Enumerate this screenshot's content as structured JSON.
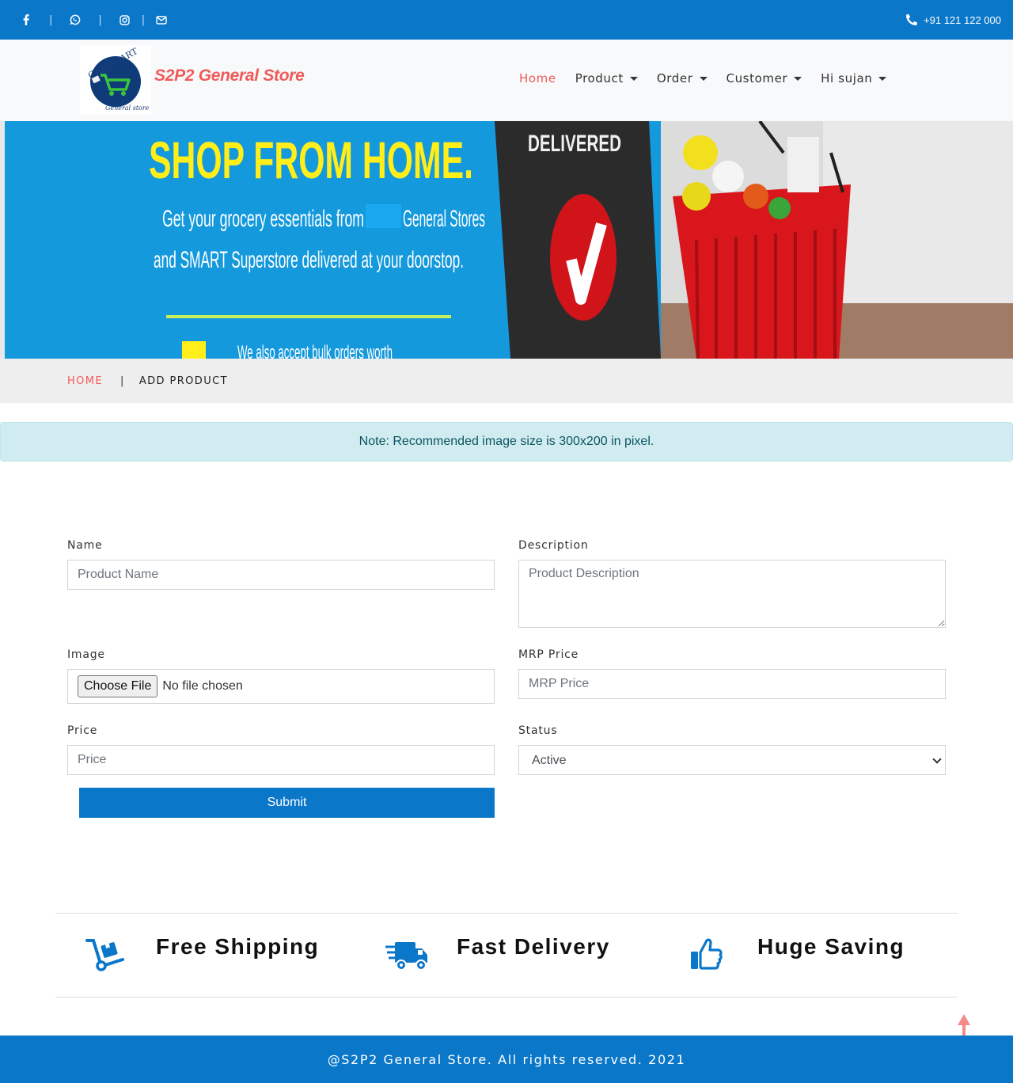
{
  "topbar": {
    "social_icons": [
      "facebook-icon",
      "whatsapp-icon",
      "instagram-icon",
      "envelope-icon"
    ],
    "separator": "|",
    "phone": "+91 121 122 000"
  },
  "navbar": {
    "brand": "S2P2 General Store",
    "logo_text_top": "GrocSMART",
    "logo_text_bottom": "General store",
    "items": [
      {
        "label": "Home",
        "active": true,
        "dropdown": false
      },
      {
        "label": "Product",
        "active": false,
        "dropdown": true
      },
      {
        "label": "Order",
        "active": false,
        "dropdown": true
      },
      {
        "label": "Customer",
        "active": false,
        "dropdown": true
      },
      {
        "label": "Hi sujan",
        "active": false,
        "dropdown": true
      }
    ]
  },
  "banner": {
    "headline": "SHOP FROM HOME.",
    "line1": "Get your grocery essentials from",
    "line1_end": "General Stores",
    "line2": "and SMART Superstore delivered at your doorstop.",
    "line3": "We also accept bulk orders worth",
    "tablet_text": "DELIVERED"
  },
  "breadcrumb": {
    "home": "HOME",
    "separator": "|",
    "current": "ADD PRODUCT"
  },
  "alert": {
    "text": "Note: Recommended image size is 300x200 in pixel."
  },
  "form": {
    "name_label": "Name",
    "name_placeholder": "Product Name",
    "description_label": "Description",
    "description_placeholder": "Product Description",
    "image_label": "Image",
    "choose_file": "Choose File",
    "no_file": "No file chosen",
    "mrp_label": "MRP Price",
    "mrp_placeholder": "MRP Price",
    "price_label": "Price",
    "price_placeholder": "Price",
    "status_label": "Status",
    "status_selected": "Active",
    "submit": "Submit"
  },
  "features": [
    {
      "icon": "dolly-icon",
      "label": "Free Shipping"
    },
    {
      "icon": "truck-icon",
      "label": "Fast Delivery"
    },
    {
      "icon": "thumbs-up-icon",
      "label": "Huge Saving"
    }
  ],
  "footer": {
    "text": "@S2P2 General Store. All rights reserved. 2021"
  },
  "colors": {
    "primary": "#0b77c9",
    "accent": "#f05a5a",
    "alert_bg": "#d1ecf1"
  }
}
